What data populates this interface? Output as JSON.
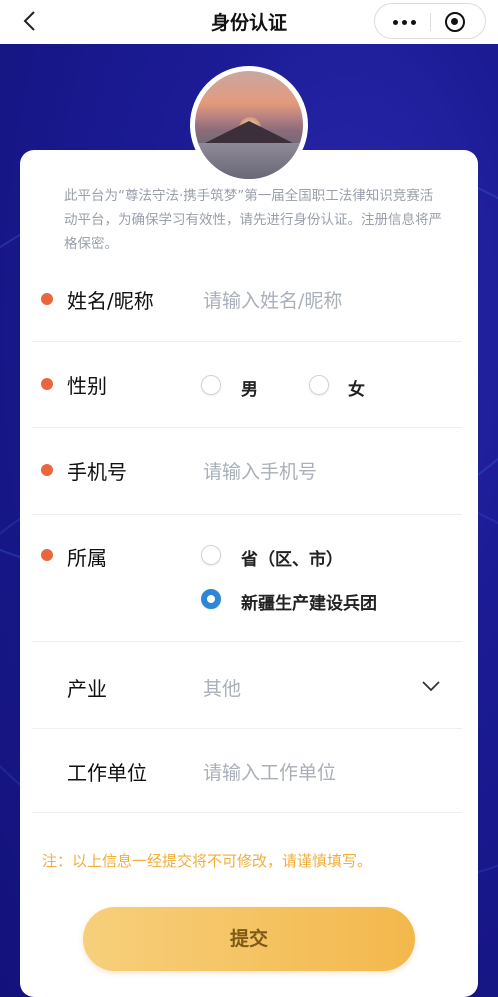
{
  "topbar": {
    "title": "身份认证"
  },
  "intro": "此平台为“尊法守法·携手筑梦”第一届全国职工法律知识竞赛活动平台，为确保学习有效性，请先进行身份认证。注册信息将严格保密。",
  "form": {
    "name": {
      "label": "姓名/昵称",
      "placeholder": "请输入姓名/昵称",
      "required": true
    },
    "gender": {
      "label": "性别",
      "required": true,
      "options": [
        "男",
        "女"
      ],
      "selected": null
    },
    "phone": {
      "label": "手机号",
      "placeholder": "请输入手机号",
      "required": true
    },
    "affiliation": {
      "label": "所属",
      "required": true,
      "options": [
        "省（区、市）",
        "新疆生产建设兵团"
      ],
      "selected": "新疆生产建设兵团"
    },
    "industry": {
      "label": "产业",
      "value": "其他"
    },
    "workplace": {
      "label": "工作单位",
      "placeholder": "请输入工作单位"
    }
  },
  "note": "注：以上信息一经提交将不可修改，请谨慎填写。",
  "submit_label": "提交",
  "colors": {
    "required_dot": "#e8673e",
    "radio_selected": "#2d86d7",
    "note": "#f0ae3a",
    "submit": "#f3b84c"
  },
  "icons": [
    "back-arrow-icon",
    "more-icon",
    "close-target-icon",
    "chevron-down-icon"
  ]
}
